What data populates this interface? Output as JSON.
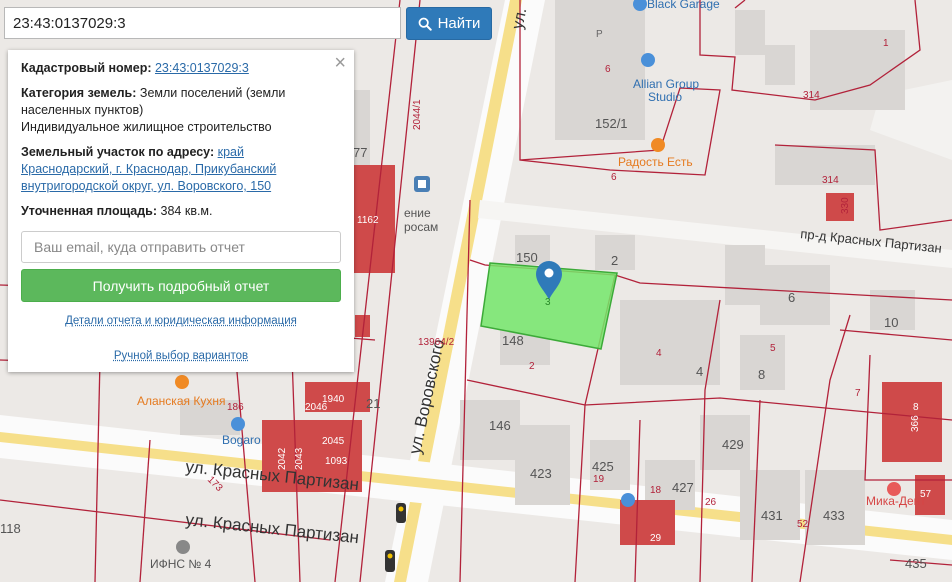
{
  "search": {
    "value": "23:43:0137029:3",
    "button_label": "Найти"
  },
  "panel": {
    "cadastral_label": "Кадастровый номер:",
    "cadastral_number": "23:43:0137029:3",
    "category_label": "Категория земель:",
    "category_value": "Земли поселений (земли населенных пунктов)",
    "usage": "Индивидуальное жилищное строительство",
    "address_label": "Земельный участок по адресу:",
    "address_value": "край Краснодарский, г. Краснодар, Прикубанский внутригородской округ, ул. Воровского, 150",
    "area_label": "Уточненная площадь:",
    "area_value": "384 кв.м.",
    "email_placeholder": "Ваш email, куда отправить отчет",
    "report_button": "Получить подробный отчет",
    "details_link": "Детали отчета и юридическая информация",
    "manual_link": "Ручной выбор вариантов"
  },
  "map": {
    "streets": {
      "vorovskogo": "ул. Воровского",
      "krasnykh_partizan_1": "ул. Красных Партизан",
      "krasnykh_partizan_2": "ул. Красных Партизан",
      "proezd": "пр-д Красных Партизан",
      "ul_top": "ул."
    },
    "pois": {
      "black_garage": "Black Garage",
      "allian_1": "Allian Group",
      "allian_2": "Studio",
      "radost": "Радость Есть",
      "alanskaya": "Аланская Кухня",
      "bogaro": "Bogaro",
      "ifns": "ИФНС № 4",
      "mika": "Мика-Дент",
      "ochenie": "ение",
      "rosam": "росам"
    },
    "numbers": {
      "n150": "150",
      "n2": "2",
      "n148": "148",
      "n2b": "2",
      "n3": "3",
      "n6": "6",
      "n4": "4",
      "n4b": "4",
      "n5": "5",
      "n8": "8",
      "n10": "10",
      "n7": "7",
      "n146": "146",
      "n423": "423",
      "n425": "425",
      "n19": "19",
      "n18": "18",
      "n427": "427",
      "n429": "429",
      "n26": "26",
      "n431": "431",
      "n52": "52",
      "n433": "433",
      "n435": "435",
      "n29": "29",
      "n57": "57",
      "n8b": "8",
      "n366": "366",
      "n152_1": "152/1",
      "n6a": "6",
      "n6b": "6",
      "n314": "314",
      "n314b": "314",
      "n330": "330",
      "n1": "1",
      "n2044": "2044/1",
      "n77": "77",
      "n1162": "1162",
      "n13964": "13964/2",
      "n21": "21",
      "n186": "186",
      "n1940": "1940",
      "n2046": "2046",
      "n2042": "2042",
      "n2043": "2043",
      "n2045": "2045",
      "n1093": "1093",
      "n173": "173",
      "n118": "118",
      "nP": "P"
    }
  }
}
